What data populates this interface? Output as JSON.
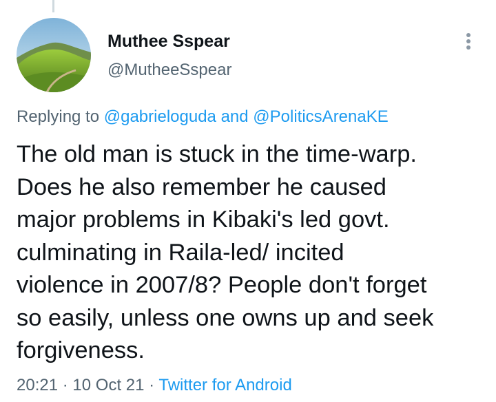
{
  "tweet": {
    "author": {
      "display_name": "Muthee Sspear",
      "handle": "@MutheeSspear"
    },
    "replying": {
      "prefix": "Replying to",
      "user1": "@gabrieloguda",
      "conjunction": "and",
      "user2": "@PoliticsArenaKE"
    },
    "text_lines": [
      "The old man is stuck in the time-warp.",
      "Does he also  remember he caused",
      "major problems in Kibaki's led govt.",
      "culminating in Raila-led/ incited",
      "violence in 2007/8? People don't forget",
      "so easily, unless one owns up and seek",
      "forgiveness."
    ],
    "meta": {
      "time": "20:21",
      "separator": "·",
      "date": "10 Oct 21",
      "source": "Twitter for Android"
    }
  },
  "icons": {
    "more": "more-vertical-icon"
  },
  "colors": {
    "link": "#1d9bf0",
    "secondary_text": "#536471",
    "primary_text": "#0f1419"
  }
}
